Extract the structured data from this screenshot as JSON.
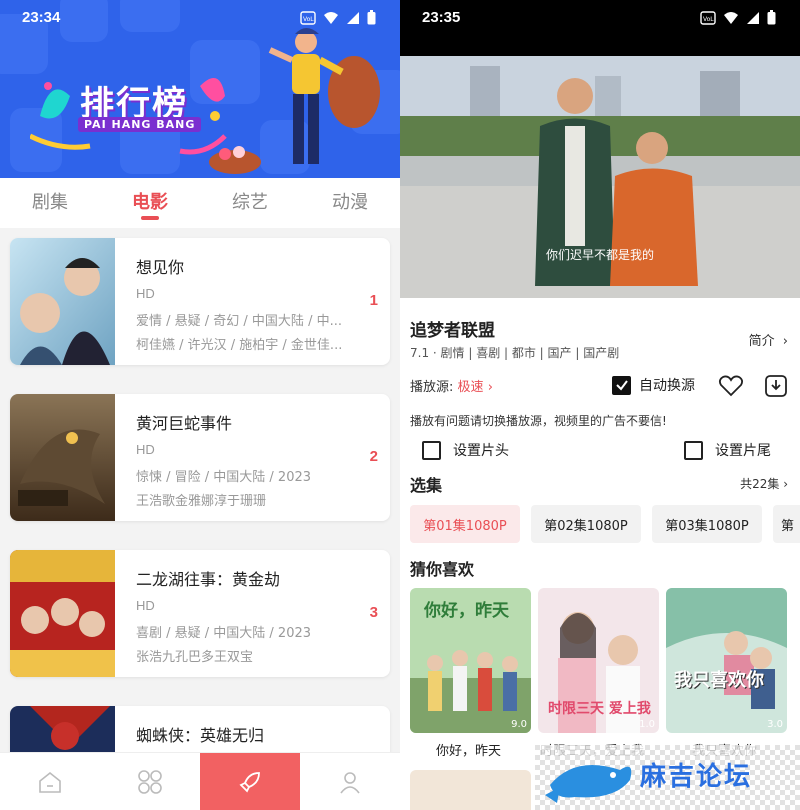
{
  "left_screen": {
    "status": {
      "time": "23:34"
    },
    "banner": {
      "title": "排行榜",
      "subtitle": "PAI HANG BANG"
    },
    "tabs": [
      {
        "label": "剧集",
        "active": false
      },
      {
        "label": "电影",
        "active": true
      },
      {
        "label": "综艺",
        "active": false
      },
      {
        "label": "动漫",
        "active": false
      }
    ],
    "items": [
      {
        "title": "想见你",
        "quality": "HD",
        "tags": "爱情 / 悬疑 / 奇幻 / 中国大陆 / 中...",
        "cast": "柯佳嬿 / 许光汉 / 施柏宇 / 金世佳...",
        "rank": "1"
      },
      {
        "title": "黄河巨蛇事件",
        "quality": "HD",
        "tags": "惊悚 / 冒险 / 中国大陆 / 2023",
        "cast": "王浩歌金雅娜淳于珊珊",
        "rank": "2"
      },
      {
        "title": "二龙湖往事：黄金劫",
        "quality": "HD",
        "tags": "喜剧 / 悬疑 / 中国大陆 / 2023",
        "cast": "张浩九孔巴多王双宝",
        "rank": "3"
      },
      {
        "title": "蜘蛛侠：英雄无归",
        "quality": "",
        "tags": "",
        "cast": "",
        "rank": ""
      }
    ],
    "bottom_nav": [
      "home-icon",
      "apps-icon",
      "rocket-icon",
      "profile-icon"
    ],
    "colors": {
      "accent": "#e94f55",
      "banner": "#2f63ea"
    }
  },
  "right_screen": {
    "status": {
      "time": "23:35"
    },
    "video": {
      "subtitle": "你们迟早不都是我的"
    },
    "detail": {
      "title": "追梦者联盟",
      "meta": "7.1 · 剧情 | 喜剧 | 都市 | 国产 | 国产剧",
      "intro": "简介",
      "source_label": "播放源:",
      "source_value": "极速",
      "auto_switch": "自动换源",
      "notice": "播放有问题请切换播放源，视频里的广告不要信!",
      "set_opening": "设置片头",
      "set_ending": "设置片尾"
    },
    "episodes": {
      "title": "选集",
      "total": "共22集",
      "items": [
        "第01集1080P",
        "第02集1080P",
        "第03集1080P",
        "第"
      ]
    },
    "recommend": {
      "title": "猜你喜欢",
      "items": [
        {
          "label": "你好，昨天",
          "score": "9.0",
          "poster_text": "你好，昨天"
        },
        {
          "label": "时限三天，爱上我",
          "score": "1.0",
          "poster_text": "时限三天 爱上我"
        },
        {
          "label": "我只喜欢你",
          "score": "3.0",
          "poster_text": "我只喜欢你"
        }
      ]
    },
    "watermark": "麻吉论坛"
  }
}
